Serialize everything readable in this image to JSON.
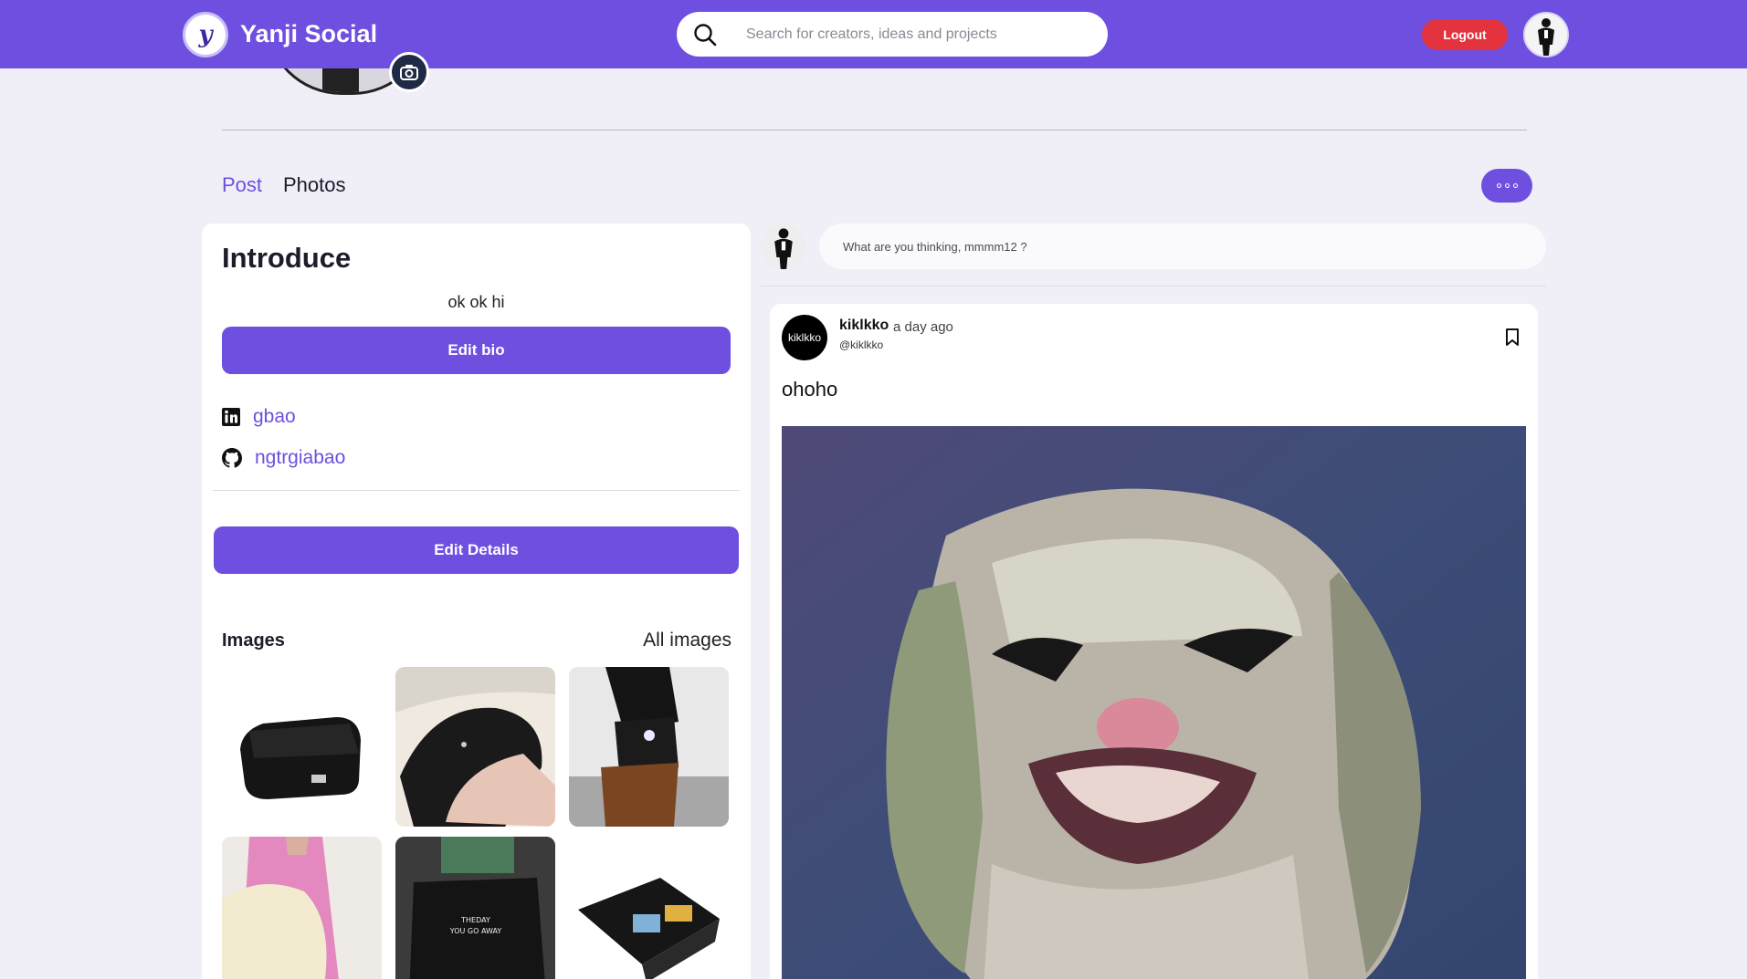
{
  "header": {
    "logo_letter": "y",
    "brand": "Yanji Social",
    "search_placeholder": "Search for creators, ideas and projects",
    "logout_label": "Logout",
    "accent": "#6e4fe0",
    "logout_color": "#e2333f"
  },
  "tabs": [
    {
      "label": "Post",
      "active": true
    },
    {
      "label": "Photos",
      "active": false
    }
  ],
  "intro": {
    "title": "Introduce",
    "bio": "ok ok hi",
    "edit_bio_label": "Edit bio",
    "links": [
      {
        "icon": "linkedin-icon",
        "label": "gbao"
      },
      {
        "icon": "github-icon",
        "label": "ngtrgiabao"
      }
    ],
    "edit_details_label": "Edit Details",
    "images_title": "Images",
    "all_images_label": "All images"
  },
  "composer": {
    "placeholder": "What are you thinking, mmmm12 ?"
  },
  "post": {
    "avatar_text": "kiklkko",
    "username": "kiklkko",
    "time": "a day ago",
    "handle": "@kiklkko",
    "text": "ohoho"
  }
}
